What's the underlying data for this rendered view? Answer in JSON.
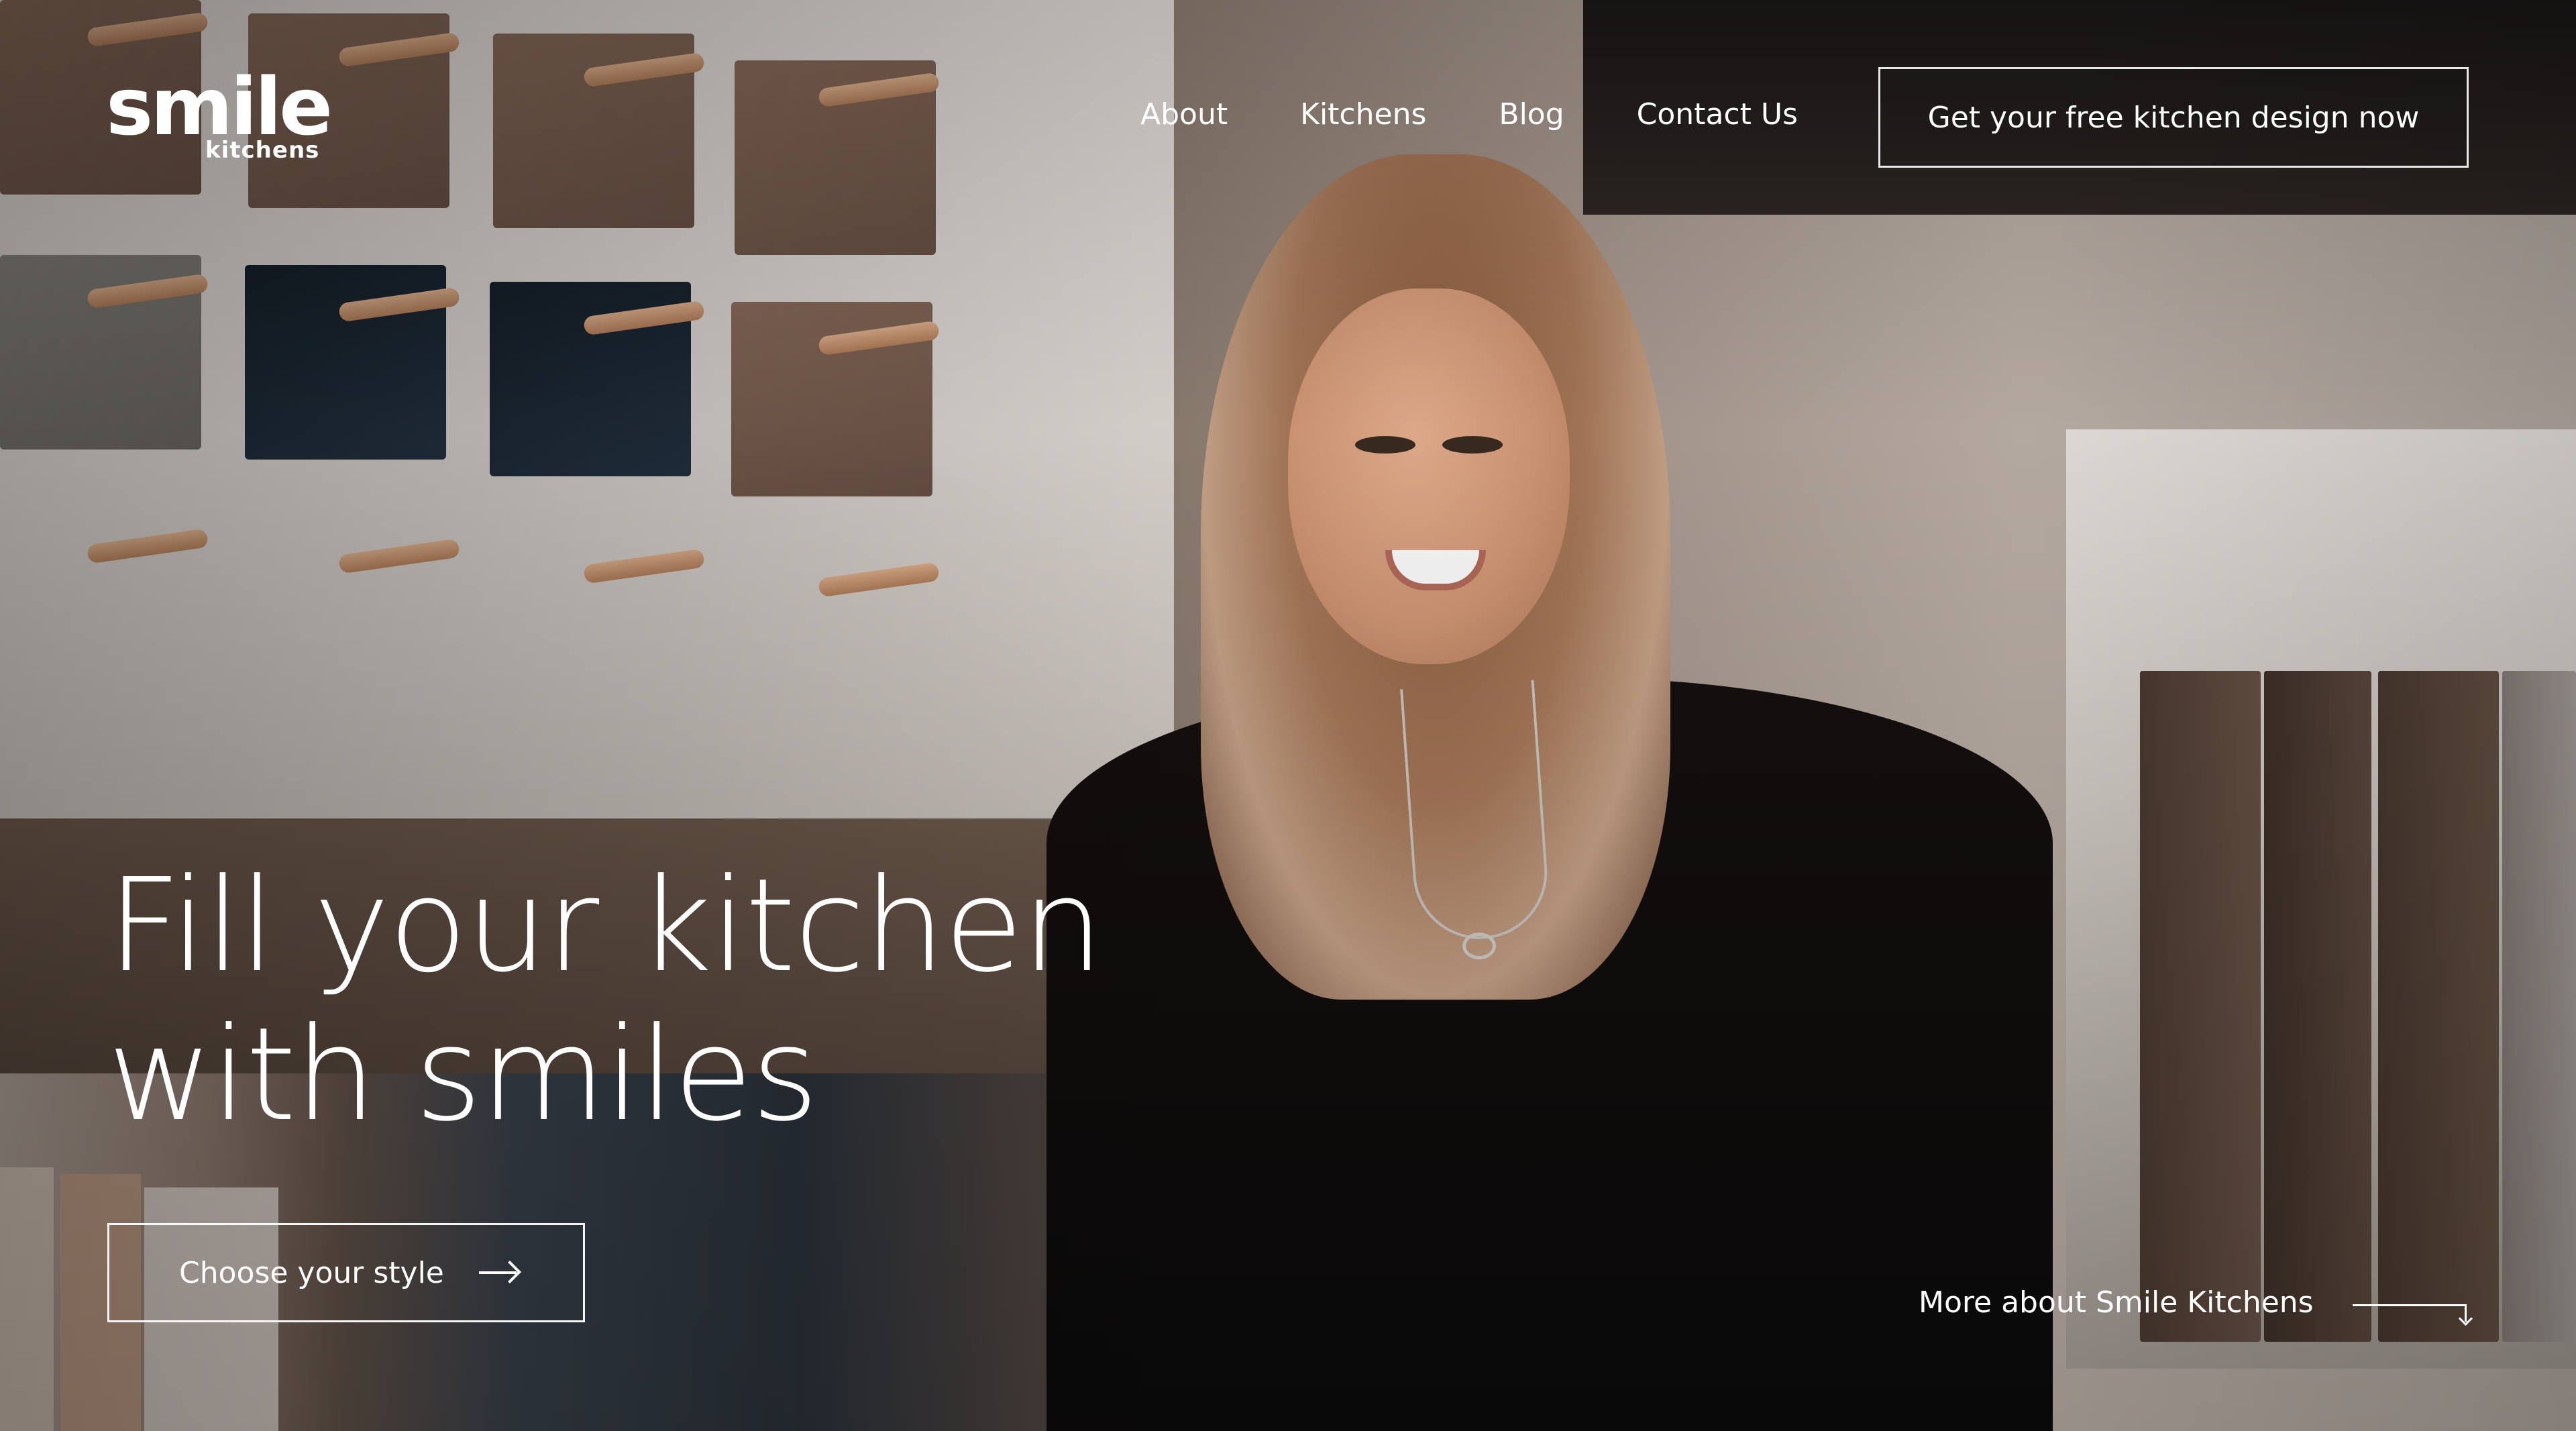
{
  "brand": {
    "logo_word": "smile",
    "logo_sub": "kitchens"
  },
  "nav": {
    "items": [
      {
        "label": "About"
      },
      {
        "label": "Kitchens"
      },
      {
        "label": "Blog"
      },
      {
        "label": "Contact Us"
      }
    ],
    "cta_label": "Get your free kitchen design now"
  },
  "hero": {
    "title_line1": "Fill your kitchen",
    "title_line2": "with smiles",
    "cta_label": "Choose your style",
    "more_link_label": "More about Smile Kitchens"
  },
  "icons": {
    "cta_arrow": "arrow-right-icon",
    "more_arrow": "arrow-down-right-icon"
  },
  "colors": {
    "text": "#ffffff",
    "button_border": "#ffffff"
  }
}
